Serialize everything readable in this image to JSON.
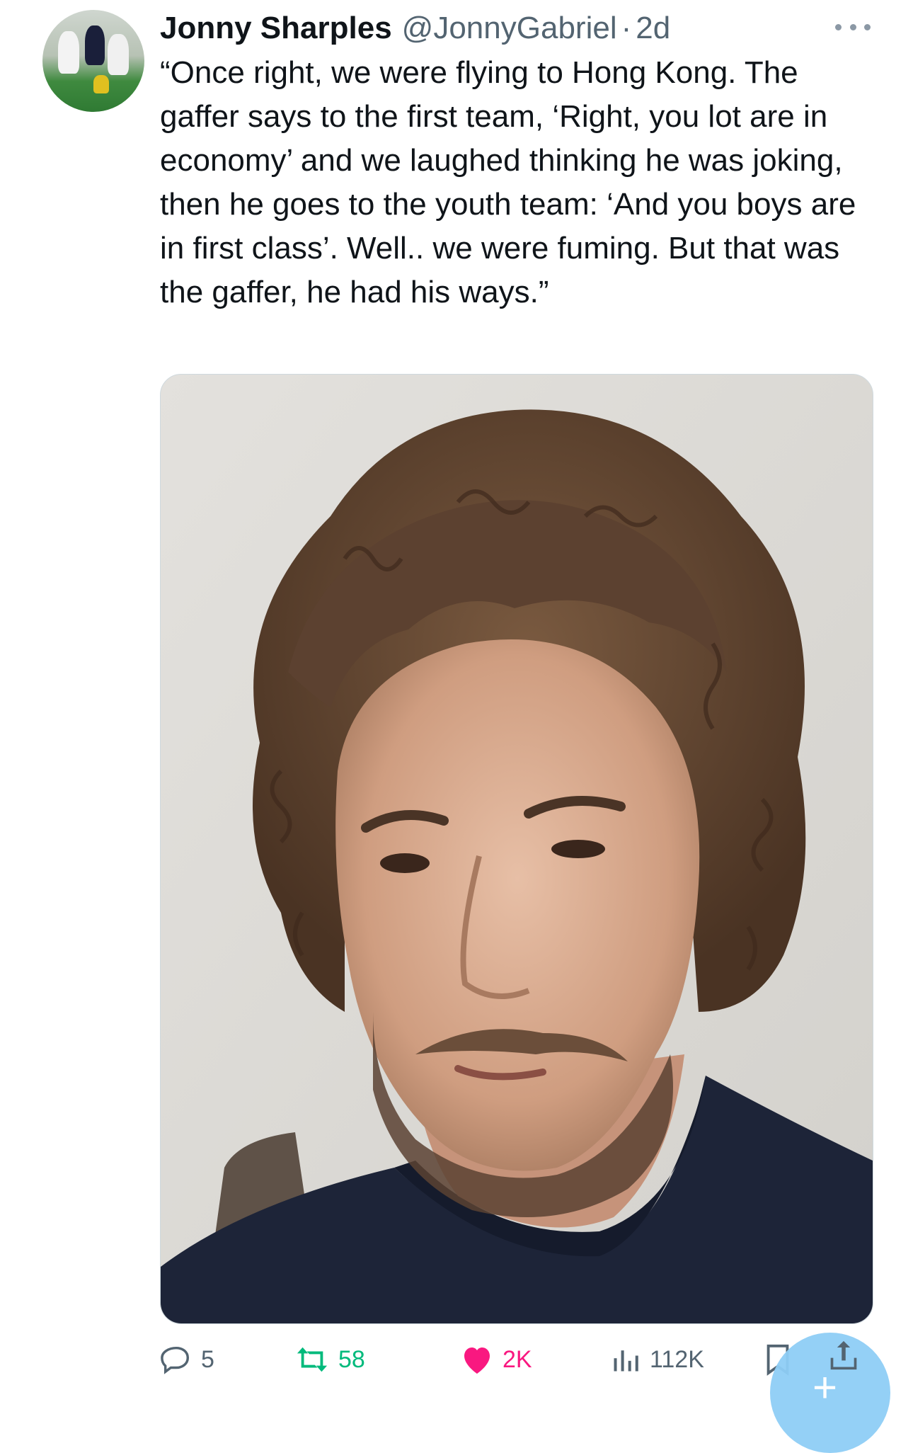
{
  "author": {
    "display_name": "Jonny Sharples",
    "handle": "@JonnyGabriel",
    "separator": "·",
    "timestamp": "2d"
  },
  "tweet": {
    "text": "“Once right, we were flying to Hong Kong. The gaffer says to the first team, ‘Right, you lot are in economy’ and we laughed thinking he was joking, then he goes to the youth team: ‘And you boys are in first class’. Well.. we were fuming. But that was the gaffer, he had his ways.”"
  },
  "media": {
    "type": "photo",
    "icon": "photo-portrait-man-curly-hair"
  },
  "actions": {
    "replies": "5",
    "retweets": "58",
    "likes": "2K",
    "views": "112K"
  },
  "colors": {
    "secondary_text": "#536471",
    "retweet_active": "#00ba7c",
    "like_active": "#f91880",
    "fab": "#8ecdf6"
  },
  "icons": {
    "more": "more-dots-icon",
    "reply": "reply-bubble-icon",
    "retweet": "retweet-arrows-icon",
    "like": "heart-filled-icon",
    "views": "bar-chart-icon",
    "bookmark": "bookmark-icon",
    "share": "share-upload-icon",
    "compose": "plus-icon"
  }
}
